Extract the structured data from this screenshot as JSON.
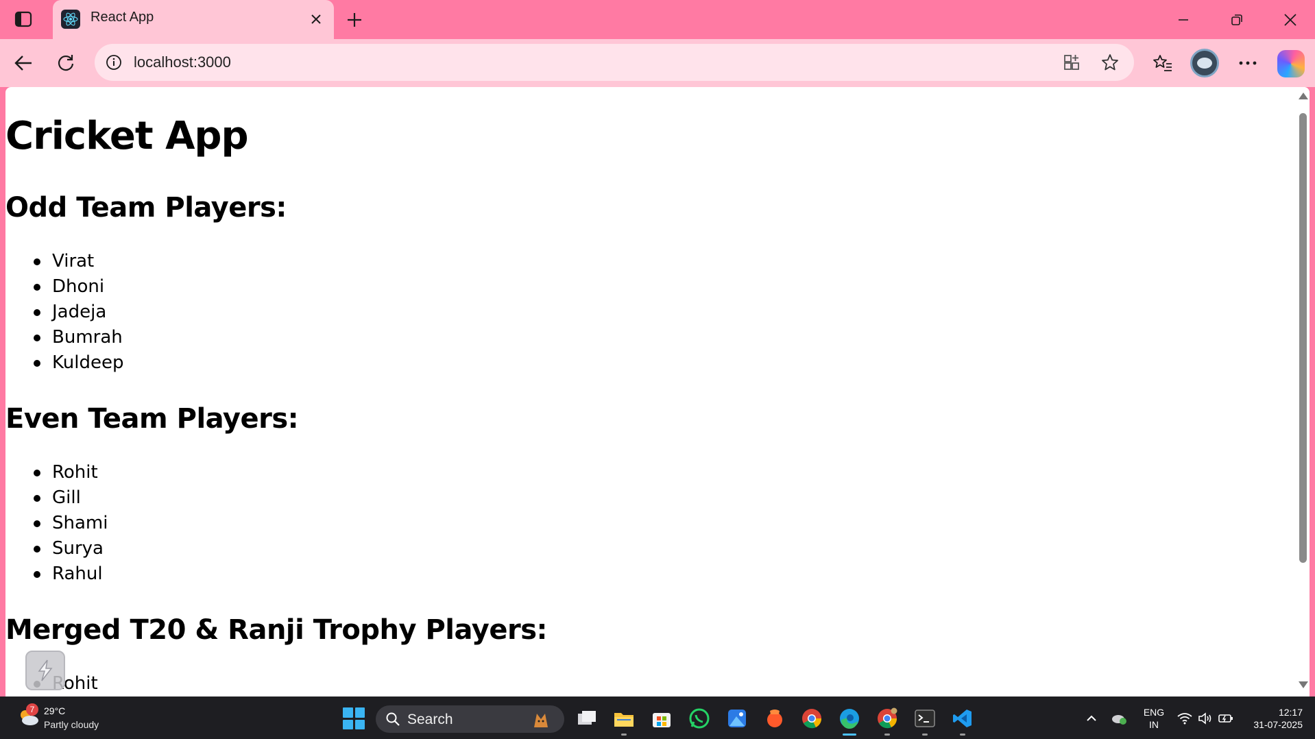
{
  "browser": {
    "tab": {
      "title": "React App",
      "favicon": "react-logo-icon"
    },
    "address": "localhost:3000",
    "theme_color": "#ff7aa3",
    "toolbar_color": "#ffc6d6"
  },
  "page": {
    "title": "Cricket App",
    "sections": [
      {
        "heading": "Odd Team Players:",
        "players": [
          "Virat",
          "Dhoni",
          "Jadeja",
          "Bumrah",
          "Kuldeep"
        ]
      },
      {
        "heading": "Even Team Players:",
        "players": [
          "Rohit",
          "Gill",
          "Shami",
          "Surya",
          "Rahul"
        ]
      },
      {
        "heading": "Merged T20 & Ranji Trophy Players:",
        "players": [
          "Rohit"
        ]
      }
    ]
  },
  "taskbar": {
    "weather": {
      "badge": "7",
      "temp": "29°C",
      "desc": "Partly cloudy"
    },
    "search_label": "Search",
    "apps": [
      "task-view",
      "file-explorer",
      "microsoft-store",
      "whatsapp",
      "photos",
      "brave",
      "chrome",
      "edge",
      "chrome-canary",
      "terminal",
      "vscode"
    ],
    "lang": {
      "line1": "ENG",
      "line2": "IN"
    },
    "clock": {
      "time": "12:17",
      "date": "31-07-2025"
    }
  }
}
